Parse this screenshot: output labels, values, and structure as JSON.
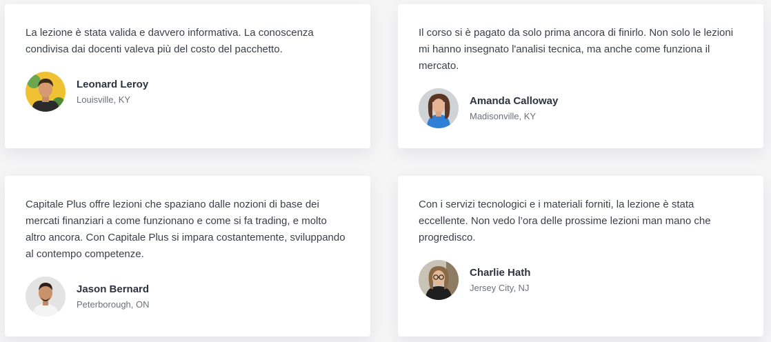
{
  "testimonials": [
    {
      "quote": "La lezione è stata valida e davvero informativa. La conoscenza condivisa dai docenti valeva più del costo del pacchetto.",
      "name": "Leonard Leroy",
      "location": "Louisville, KY",
      "avatar_icon": "person-avatar-icon",
      "avatar_bg": "#f0c233"
    },
    {
      "quote": "Il corso si è pagato da solo prima ancora di finirlo. Non solo le lezioni mi hanno insegnato l'analisi tecnica, ma anche come funziona il mercato.",
      "name": "Amanda Calloway",
      "location": "Madisonville, KY",
      "avatar_icon": "person-avatar-icon",
      "avatar_bg": "#cfd3d6"
    },
    {
      "quote": "Capitale Plus offre lezioni che spaziano dalle nozioni di base dei mercati finanziari a come funzionano e come si fa trading, e molto altro ancora. Con Capitale Plus si impara costantemente, sviluppando al contempo competenze.",
      "name": "Jason Bernard",
      "location": "Peterborough, ON",
      "avatar_icon": "person-avatar-icon",
      "avatar_bg": "#e3e3e3"
    },
    {
      "quote": "Con i servizi tecnologici e i materiali forniti, la lezione è stata eccellente. Non vedo l’ora delle prossime lezioni man mano che progredisco.",
      "name": "Charlie Hath",
      "location": "Jersey City, NJ",
      "avatar_icon": "person-avatar-icon",
      "avatar_bg": "#c9c2b6"
    }
  ]
}
